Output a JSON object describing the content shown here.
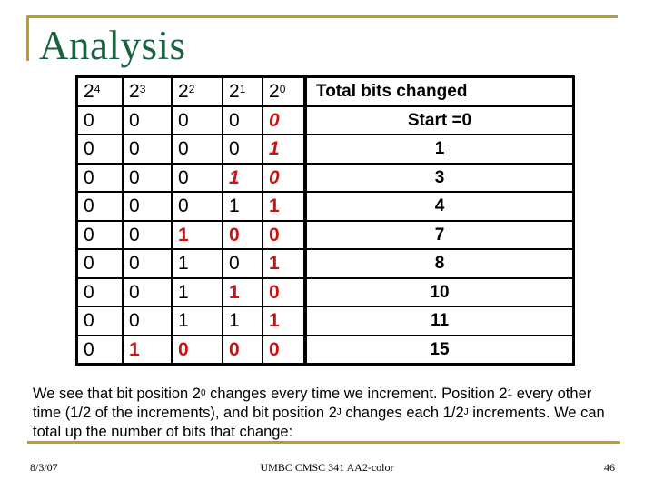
{
  "slide": {
    "title": "Analysis",
    "colors": {
      "title": "#1a6140",
      "frame": "#c49a2a",
      "changed_bit": "#cc1111"
    }
  },
  "table": {
    "headers": [
      {
        "base": "2",
        "exp": "4"
      },
      {
        "base": "2",
        "exp": "3"
      },
      {
        "base": "2",
        "exp": "2"
      },
      {
        "base": "2",
        "exp": "1"
      },
      {
        "base": "2",
        "exp": "0"
      }
    ],
    "total_header": "Total bits changed",
    "rows": [
      {
        "bits": [
          "0",
          "0",
          "0",
          "0",
          "0"
        ],
        "changed": [
          false,
          false,
          false,
          false,
          true
        ],
        "italic": true,
        "total": "Start =0"
      },
      {
        "bits": [
          "0",
          "0",
          "0",
          "0",
          "1"
        ],
        "changed": [
          false,
          false,
          false,
          false,
          true
        ],
        "italic": true,
        "total": "1"
      },
      {
        "bits": [
          "0",
          "0",
          "0",
          "1",
          "0"
        ],
        "changed": [
          false,
          false,
          false,
          true,
          true
        ],
        "italic": true,
        "total": "3"
      },
      {
        "bits": [
          "0",
          "0",
          "0",
          "1",
          "1"
        ],
        "changed": [
          false,
          false,
          false,
          false,
          true
        ],
        "italic": false,
        "total": "4"
      },
      {
        "bits": [
          "0",
          "0",
          "1",
          "0",
          "0"
        ],
        "changed": [
          false,
          false,
          true,
          true,
          true
        ],
        "italic": false,
        "total": "7"
      },
      {
        "bits": [
          "0",
          "0",
          "1",
          "0",
          "1"
        ],
        "changed": [
          false,
          false,
          false,
          false,
          true
        ],
        "italic": false,
        "total": "8"
      },
      {
        "bits": [
          "0",
          "0",
          "1",
          "1",
          "0"
        ],
        "changed": [
          false,
          false,
          false,
          true,
          true
        ],
        "italic": false,
        "total": "10"
      },
      {
        "bits": [
          "0",
          "0",
          "1",
          "1",
          "1"
        ],
        "changed": [
          false,
          false,
          false,
          false,
          true
        ],
        "italic": false,
        "total": "11"
      },
      {
        "bits": [
          "0",
          "1",
          "0",
          "0",
          "0"
        ],
        "changed": [
          false,
          true,
          true,
          true,
          true
        ],
        "italic": false,
        "total": "15"
      }
    ]
  },
  "paragraph": {
    "part1": "We see that bit position 2",
    "sup1": "0",
    "part2": " changes every time we increment. Position 2",
    "sup2": "1",
    "part3": " every other time (1/2 of the increments), and  bit position 2",
    "sup3": "J",
    "part4": " changes each 1/2",
    "sup4": "J",
    "part5": " increments. We can total up the number of bits that change:"
  },
  "footer": {
    "date": "8/3/07",
    "course": "UMBC CMSC 341 AA2-color",
    "page": "46"
  }
}
